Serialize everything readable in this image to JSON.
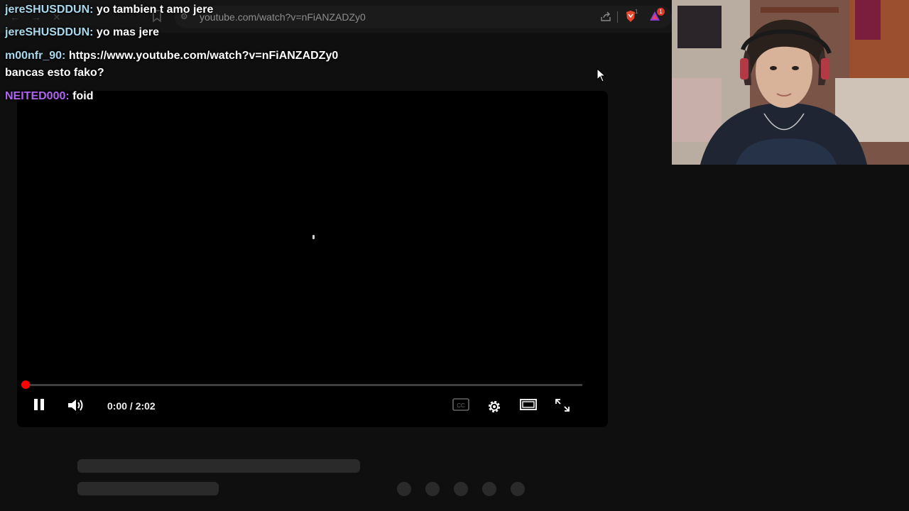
{
  "browser": {
    "back_icon": "arrow-left-icon",
    "forward_icon": "arrow-right-icon",
    "stop_icon": "close-icon",
    "bookmark_icon": "bookmark-icon",
    "url": "youtube.com/watch?v=nFiANZADZy0",
    "brave_badge": "1",
    "rewards_badge": "1"
  },
  "chat": {
    "messages": [
      {
        "user": "jereSHUSDDUN:",
        "text": "yo tambien t amo jere"
      },
      {
        "user": "jereSHUSDDUN:",
        "text": "yo mas jere"
      },
      {
        "user": "m00nfr_90:",
        "text": "https://www.youtube.com/watch?v=nFiANZADZy0",
        "text2": "bancas esto fako?"
      },
      {
        "user": "NEITED000:",
        "text": "foid"
      }
    ],
    "colors": {
      "user_default": "#a8d8ec",
      "user_purple": "#b065f0"
    }
  },
  "player": {
    "state": "paused-playing",
    "time": "0:00 / 2:02",
    "progress": 0.0,
    "accent": "#ff0000",
    "icons": [
      "pause-icon",
      "volume-icon",
      "cc-icon",
      "settings-icon",
      "theater-icon",
      "fullscreen-icon"
    ]
  },
  "webcam": {
    "description_icon": "webcam-feed"
  }
}
